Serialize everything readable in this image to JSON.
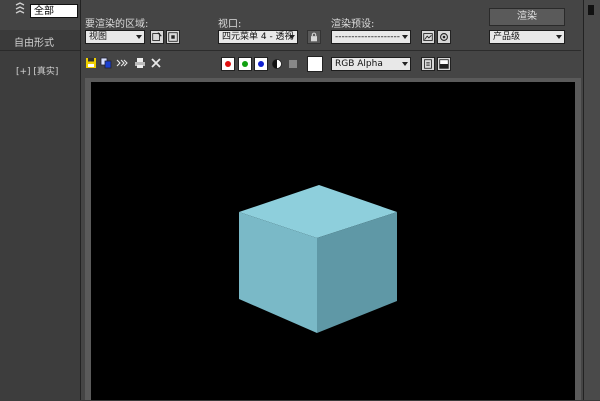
{
  "background_app": {
    "select_value": "全部",
    "tab_label": "自由形式",
    "viewport_label": "[+] [真实]"
  },
  "render_frame": {
    "area_label": "要渲染的区域:",
    "area_value": "视图",
    "viewport_label": "视口:",
    "viewport_value": "四元菜单 4 - 透视",
    "preset_label": "渲染预设:",
    "preset_value": "--------------------",
    "render_button": "渲染",
    "quality_value": "产品级",
    "channel_value": "RGB Alpha"
  },
  "colors": {
    "red_channel": "#e01010",
    "green_channel": "#10a010",
    "blue_channel": "#1020d0",
    "canvas_bg": "#000000",
    "cube_top": "#8ecfdc",
    "cube_left": "#7ab9c7",
    "cube_right": "#5f98a6"
  },
  "icons": [
    "save-image-icon",
    "copy-image-icon",
    "clone-frame-icon",
    "print-icon",
    "clear-icon",
    "monochrome-icon",
    "lock-icon",
    "render-setup-icon",
    "environment-icon",
    "display-toggle-icon"
  ]
}
